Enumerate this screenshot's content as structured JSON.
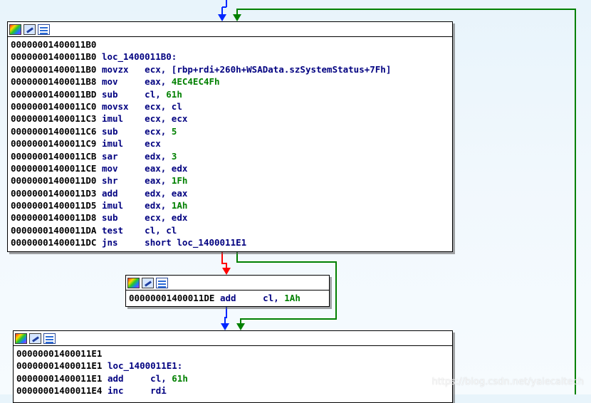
{
  "colors": {
    "edge_normal": "#0026ff",
    "edge_true": "#008000",
    "edge_false": "#ff0000",
    "mnemonic": "#000080",
    "number": "#008000"
  },
  "node_header_icons": [
    "color-palette-icon",
    "edit-icon",
    "graph-icon"
  ],
  "nodes": [
    {
      "id": "block1",
      "lines": [
        {
          "addr": "00000001400011B0",
          "mn": "",
          "op": "",
          "num": "",
          "tail": ""
        },
        {
          "addr": "00000001400011B0",
          "mn": "loc_1400011B0:",
          "op": "",
          "num": "",
          "tail": ""
        },
        {
          "addr": "00000001400011B0",
          "mn": "movzx",
          "op": "ecx, [rbp+rdi+260h+WSAData.szSystemStatus+7Fh]",
          "num": "",
          "tail": ""
        },
        {
          "addr": "00000001400011B8",
          "mn": "mov",
          "op": "eax, ",
          "num": "4EC4EC4Fh",
          "tail": ""
        },
        {
          "addr": "00000001400011BD",
          "mn": "sub",
          "op": "cl, ",
          "num": "61h",
          "tail": ""
        },
        {
          "addr": "00000001400011C0",
          "mn": "movsx",
          "op": "ecx, cl",
          "num": "",
          "tail": ""
        },
        {
          "addr": "00000001400011C3",
          "mn": "imul",
          "op": "ecx, ecx",
          "num": "",
          "tail": ""
        },
        {
          "addr": "00000001400011C6",
          "mn": "sub",
          "op": "ecx, ",
          "num": "5",
          "tail": ""
        },
        {
          "addr": "00000001400011C9",
          "mn": "imul",
          "op": "ecx",
          "num": "",
          "tail": ""
        },
        {
          "addr": "00000001400011CB",
          "mn": "sar",
          "op": "edx, ",
          "num": "3",
          "tail": ""
        },
        {
          "addr": "00000001400011CE",
          "mn": "mov",
          "op": "eax, edx",
          "num": "",
          "tail": ""
        },
        {
          "addr": "00000001400011D0",
          "mn": "shr",
          "op": "eax, ",
          "num": "1Fh",
          "tail": ""
        },
        {
          "addr": "00000001400011D3",
          "mn": "add",
          "op": "edx, eax",
          "num": "",
          "tail": ""
        },
        {
          "addr": "00000001400011D5",
          "mn": "imul",
          "op": "edx, ",
          "num": "1Ah",
          "tail": ""
        },
        {
          "addr": "00000001400011D8",
          "mn": "sub",
          "op": "ecx, edx",
          "num": "",
          "tail": ""
        },
        {
          "addr": "00000001400011DA",
          "mn": "test",
          "op": "cl, cl",
          "num": "",
          "tail": ""
        },
        {
          "addr": "00000001400011DC",
          "mn": "jns",
          "op": "short loc_1400011E1",
          "num": "",
          "tail": ""
        }
      ]
    },
    {
      "id": "block2",
      "lines": [
        {
          "addr": "00000001400011DE",
          "mn": "add",
          "op": "cl, ",
          "num": "1Ah",
          "tail": ""
        }
      ]
    },
    {
      "id": "block3",
      "lines": [
        {
          "addr": "00000001400011E1",
          "mn": "",
          "op": "",
          "num": "",
          "tail": ""
        },
        {
          "addr": "00000001400011E1",
          "mn": "loc_1400011E1:",
          "op": "",
          "num": "",
          "tail": ""
        },
        {
          "addr": "00000001400011E1",
          "mn": "add",
          "op": "cl, ",
          "num": "61h",
          "tail": ""
        },
        {
          "addr": "00000001400011E4",
          "mn": "inc",
          "op": "rdi",
          "num": "",
          "tail": ""
        }
      ]
    }
  ],
  "watermark": "https://blog.csdn.net/yalecaltech"
}
